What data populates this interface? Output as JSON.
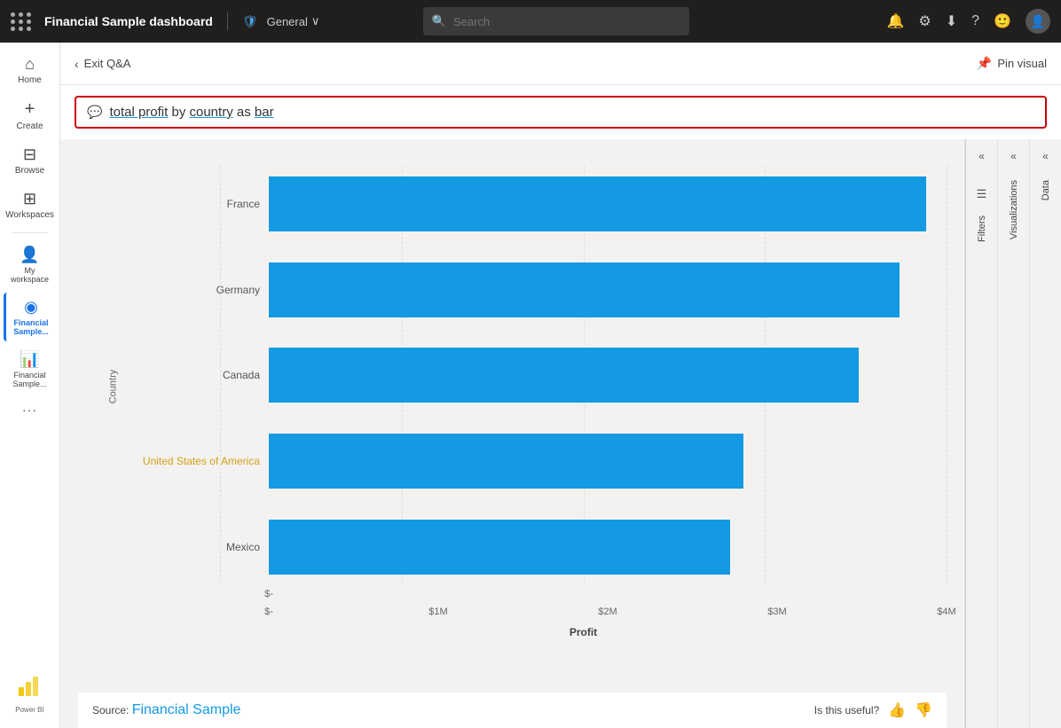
{
  "topnav": {
    "dots": [
      1,
      2,
      3,
      4,
      5,
      6,
      7,
      8,
      9
    ],
    "title": "Financial Sample  dashboard",
    "shield": "🛡",
    "workspace": "General",
    "chevron": "∨",
    "search_placeholder": "Search",
    "icons": {
      "bell": "🔔",
      "gear": "⚙",
      "download": "⬇",
      "help": "?",
      "feedback": "🙂"
    }
  },
  "sidebar": {
    "items": [
      {
        "id": "home",
        "icon": "⌂",
        "label": "Home"
      },
      {
        "id": "create",
        "icon": "+",
        "label": "Create"
      },
      {
        "id": "browse",
        "icon": "▣",
        "label": "Browse"
      },
      {
        "id": "workspaces",
        "icon": "⊞",
        "label": "Workspaces"
      },
      {
        "id": "my-workspace",
        "icon": "👤",
        "label": "My workspace"
      },
      {
        "id": "financial-sample-1",
        "icon": "◉",
        "label": "Financial Sample..."
      },
      {
        "id": "financial-sample-2",
        "icon": "📊",
        "label": "Financial Sample..."
      },
      {
        "id": "more",
        "icon": "···",
        "label": ""
      }
    ],
    "active": "financial-sample-1",
    "powerbi_label": "Power BI"
  },
  "header": {
    "exit_label": "Exit Q&A",
    "pin_label": "Pin visual",
    "pin_icon": "📌"
  },
  "qna": {
    "query_icon": "💬",
    "query_text": "total profit by country as bar",
    "query_underlined": [
      "total profit",
      "country",
      "bar"
    ]
  },
  "chart": {
    "title": "total profit by country as bar",
    "y_axis_label": "Country",
    "x_axis_label": "Profit",
    "x_ticks": [
      "$-",
      "$1M",
      "$2M",
      "$3M",
      "$4M"
    ],
    "bars": [
      {
        "country": "France",
        "value": 3900000,
        "max": 4000000,
        "pct": 97,
        "highlight": false
      },
      {
        "country": "Germany",
        "value": 3700000,
        "max": 4000000,
        "pct": 93,
        "highlight": false
      },
      {
        "country": "Canada",
        "value": 3500000,
        "max": 4000000,
        "pct": 87,
        "highlight": false
      },
      {
        "country": "United States of America",
        "value": 2800000,
        "max": 4000000,
        "pct": 70,
        "highlight": true
      },
      {
        "country": "Mexico",
        "value": 2700000,
        "max": 4000000,
        "pct": 68,
        "highlight": false
      }
    ],
    "bar_color": "#1499e3"
  },
  "footer": {
    "source_prefix": "Source: ",
    "source_link": "Financial Sample",
    "useful_text": "Is this useful?",
    "thumbs_up": "👍",
    "thumbs_down": "👎"
  },
  "right_panels": {
    "filters_label": "Filters",
    "visualizations_label": "Visualizations",
    "data_label": "Data"
  }
}
